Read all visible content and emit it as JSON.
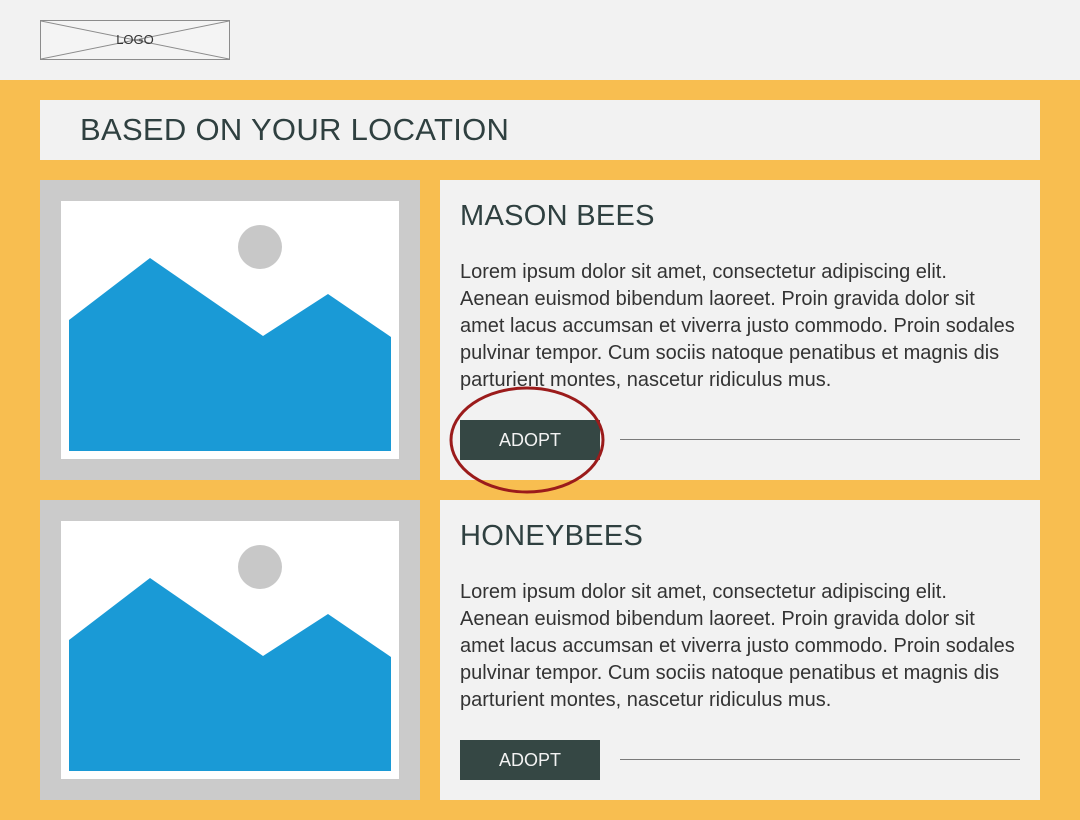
{
  "header": {
    "logo_text": "LOGO"
  },
  "section": {
    "title": "BASED ON YOUR LOCATION"
  },
  "cards": [
    {
      "title": "MASON BEES",
      "description": "Lorem ipsum dolor sit amet, consectetur adipiscing elit. Aenean euismod bibendum laoreet. Proin gravida dolor sit amet lacus accumsan et viverra justo commodo. Proin sodales pulvinar tempor. Cum sociis natoque penatibus et magnis dis parturient montes, nascetur ridiculus mus.",
      "button_label": "ADOPT"
    },
    {
      "title": "HONEYBEES",
      "description": "Lorem ipsum dolor sit amet, consectetur adipiscing elit. Aenean euismod bibendum laoreet. Proin gravida dolor sit amet lacus accumsan et viverra justo commodo. Proin sodales pulvinar tempor. Cum sociis natoque penatibus et magnis dis parturient montes, nascetur ridiculus mus.",
      "button_label": "ADOPT"
    }
  ],
  "colors": {
    "page_background": "#f8be50",
    "panel_background": "#f2f2f2",
    "button_background": "#354744",
    "image_mountain": "#1a9ad6",
    "image_sun": "#c8c8c8",
    "highlight_circle": "#9b1b1b"
  },
  "icons": {
    "logo": "logo-placeholder-icon",
    "card_image": "image-placeholder-icon"
  }
}
